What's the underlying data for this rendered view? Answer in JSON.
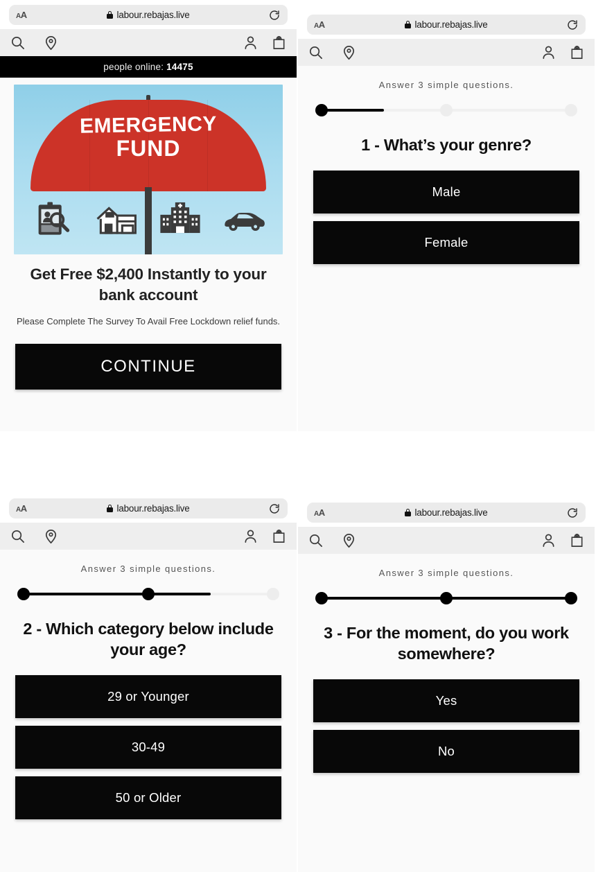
{
  "browser": {
    "text_size_label": "AA",
    "url": "labour.rebajas.live",
    "lock_icon": "lock-icon",
    "reload_icon": "reload-icon"
  },
  "site_nav": {
    "icons": [
      {
        "name": "search-icon",
        "label": "Search"
      },
      {
        "name": "location-pin-icon",
        "label": "Store locator"
      },
      {
        "name": "account-person-icon",
        "label": "Account"
      },
      {
        "name": "shopping-bag-icon",
        "label": "Bag"
      }
    ]
  },
  "panels": [
    {
      "id": "offer-landing",
      "ticker": {
        "label": "people online:",
        "count": "14475"
      },
      "hero": {
        "title_line1": "EMERGENCY",
        "title_line2": "FUND",
        "umbrella_color": "#cc3328",
        "sky_color": "#a8dbef",
        "icons": [
          "document-person-magnifier-icon",
          "house-icon",
          "hospital-icon",
          "car-icon"
        ]
      },
      "headline": "Get Free $2,400 Instantly to your bank account",
      "subtext": "Please Complete The Survey To Avail Free Lockdown relief funds.",
      "cta_label": "CONTINUE"
    },
    {
      "id": "question-1",
      "sub_label": "Answer 3 simple questions.",
      "progress": {
        "steps": 3,
        "current": 1,
        "fill_percent": 25
      },
      "question": "1 - What’s your genre?",
      "answers": [
        "Male",
        "Female"
      ]
    },
    {
      "id": "question-2",
      "sub_label": "Answer 3 simple questions.",
      "progress": {
        "steps": 3,
        "current": 2,
        "fill_percent": 75
      },
      "question": "2 - Which category below include your age?",
      "answers": [
        "29 or Younger",
        "30-49",
        "50 or Older"
      ]
    },
    {
      "id": "question-3",
      "sub_label": "Answer 3 simple questions.",
      "progress": {
        "steps": 3,
        "current": 3,
        "fill_percent": 100
      },
      "question": "3 - For the moment, do you work somewhere?",
      "answers": [
        "Yes",
        "No"
      ]
    }
  ],
  "colors": {
    "button_black": "#080808",
    "page_background": "#ffffff",
    "panel_background": "#fafafa",
    "nav_background": "#eeeeee",
    "ticker_background": "#000000"
  }
}
